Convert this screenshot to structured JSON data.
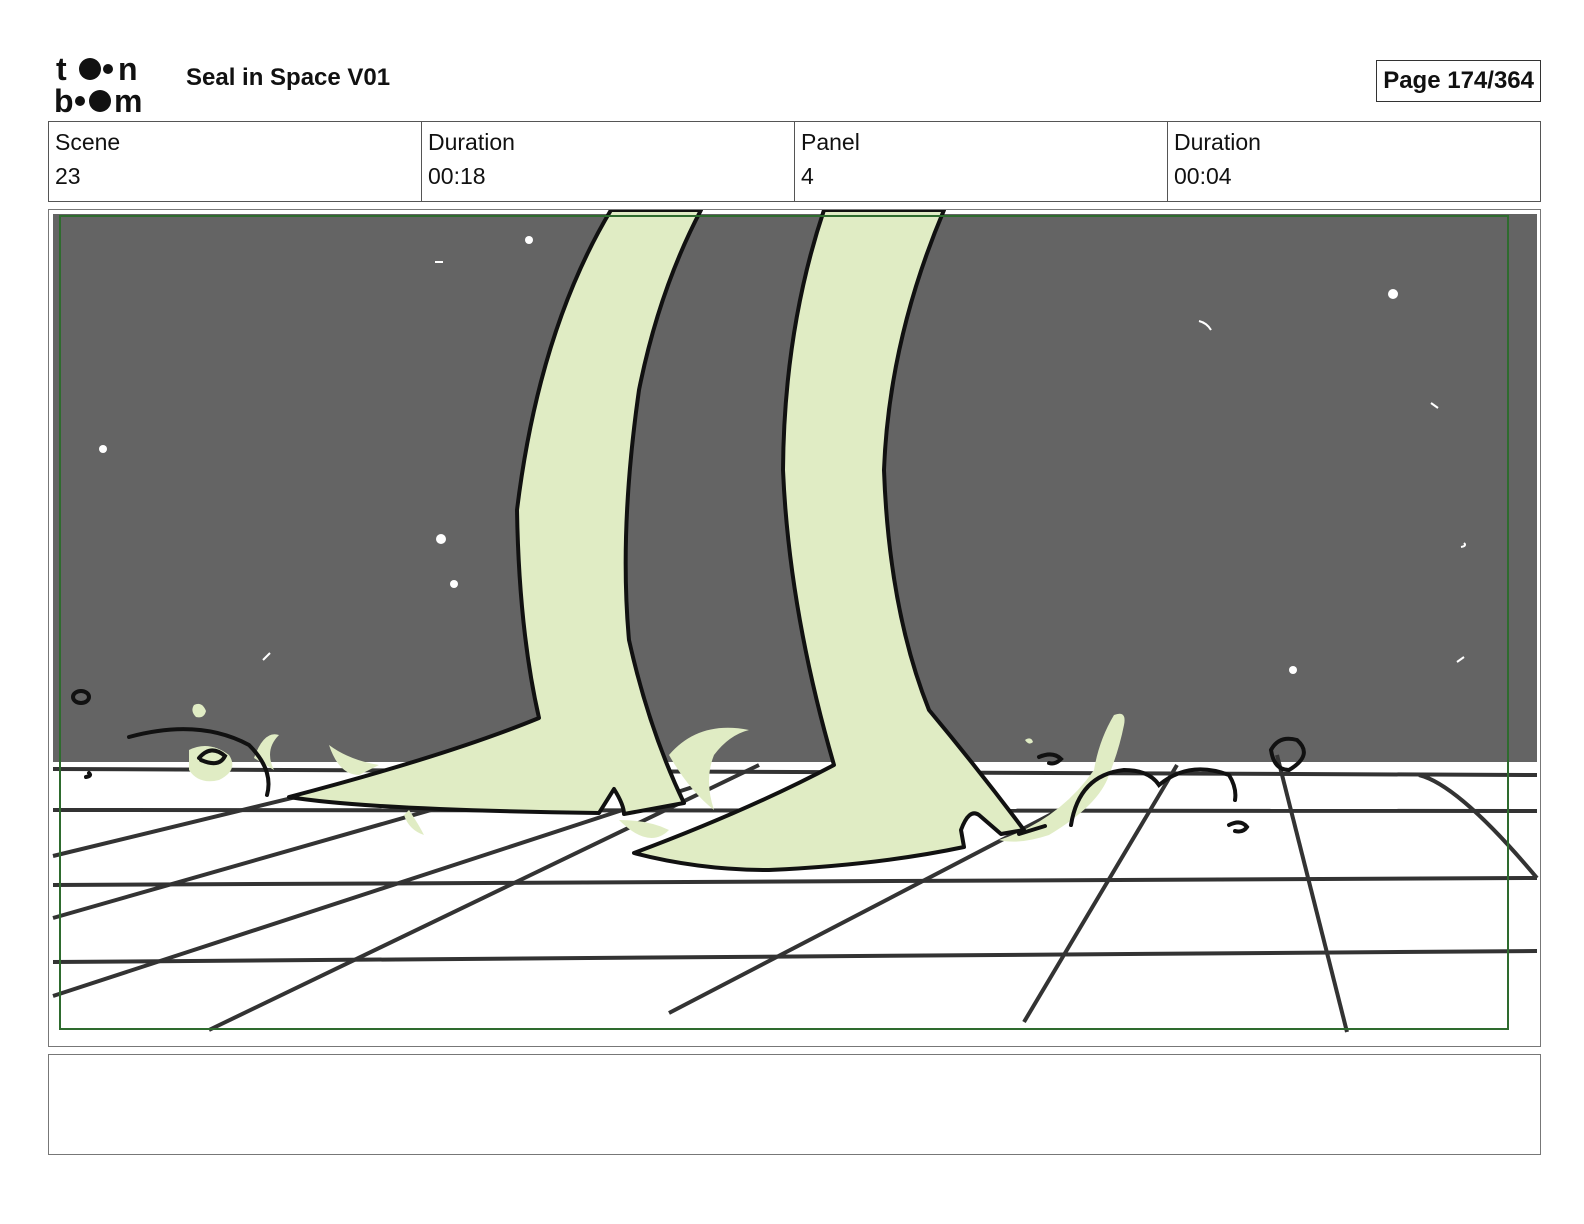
{
  "header": {
    "logo_text": "toon boom",
    "project_title": "Seal in Space V01",
    "page_label": "Page 174/364"
  },
  "info": {
    "scene_label": "Scene",
    "scene_value": "23",
    "scene_duration_label": "Duration",
    "scene_duration_value": "00:18",
    "panel_label": "Panel",
    "panel_value": "4",
    "panel_duration_label": "Duration",
    "panel_duration_value": "00:04"
  },
  "panel": {
    "notes_text": "",
    "colors": {
      "space": "#646464",
      "legs": "#e0ecc4",
      "floor": "#ffffff",
      "safe_frame": "#2e6b2e",
      "ink": "#111111"
    }
  }
}
